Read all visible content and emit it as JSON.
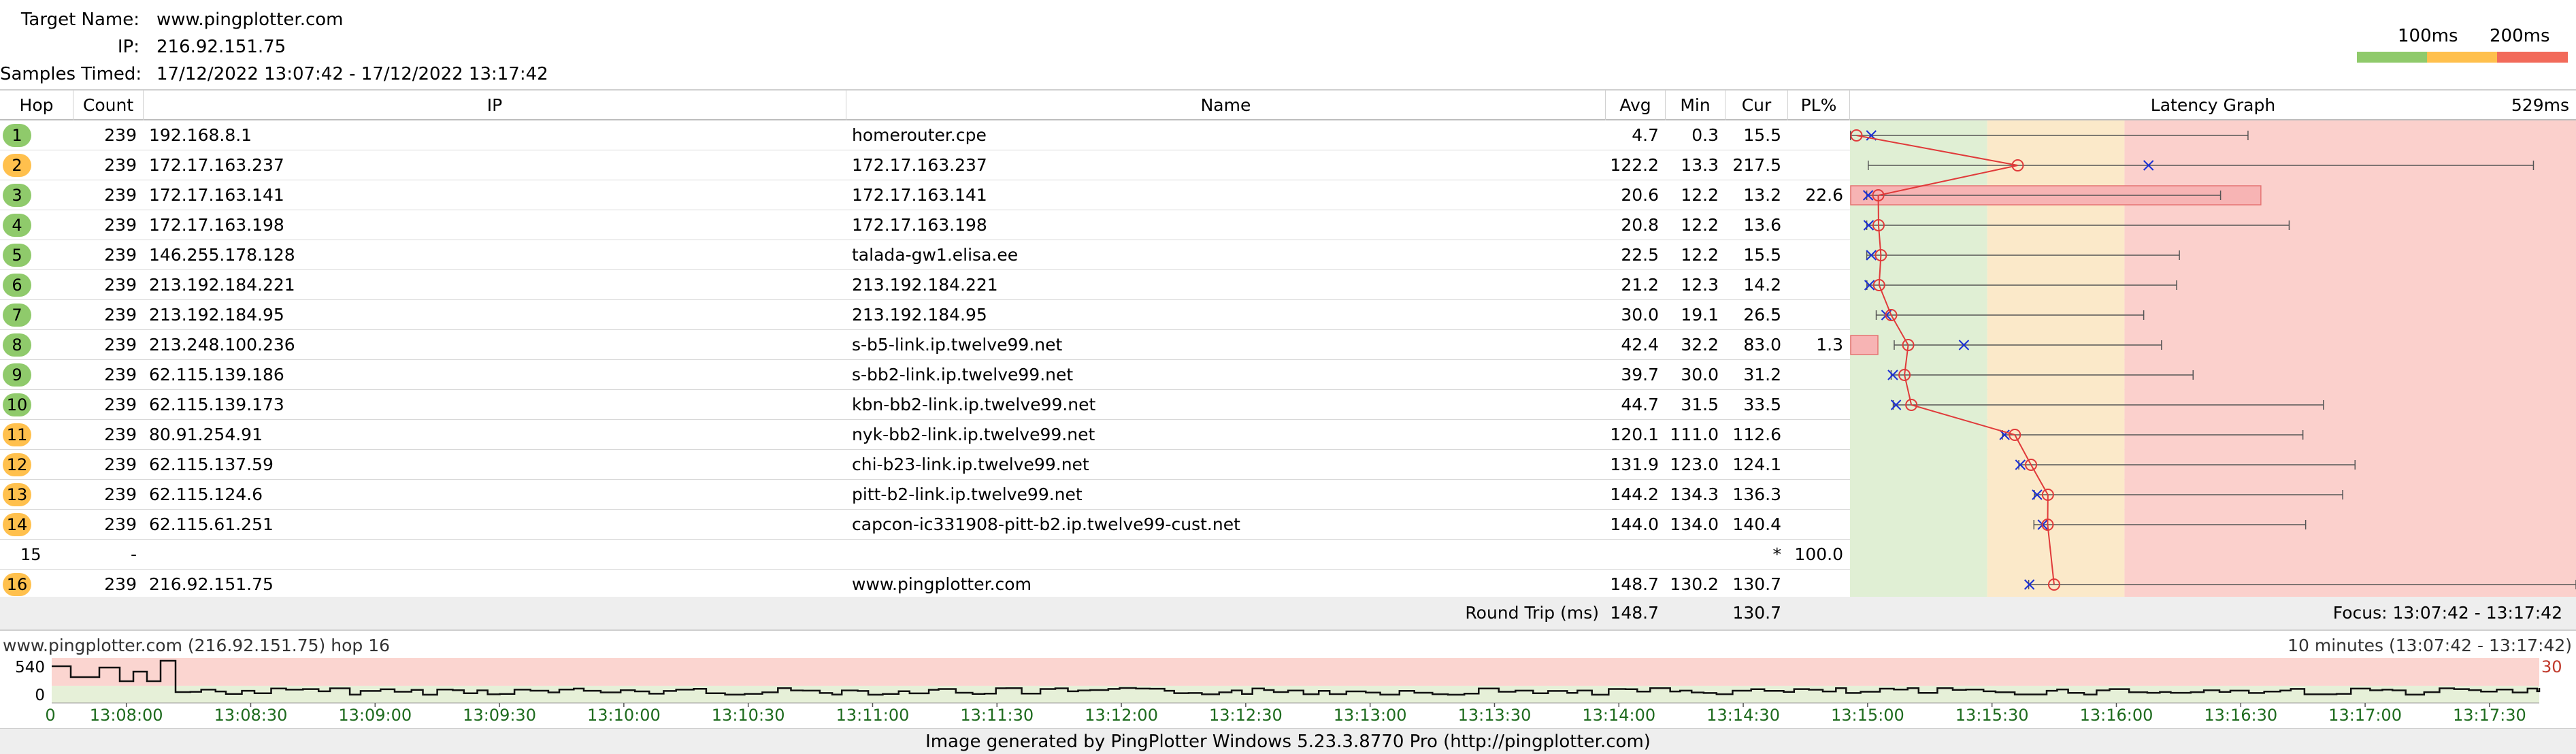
{
  "target": {
    "name_label": "Target Name:",
    "name_value": "www.pingplotter.com",
    "ip_label": "IP:",
    "ip_value": "216.92.151.75",
    "samples_label": "Samples Timed:",
    "samples_value": "17/12/2022 13:07:42 - 17/12/2022 13:17:42"
  },
  "legend": {
    "ms100": "100ms",
    "ms200": "200ms",
    "colors": {
      "good": "#8fca6b",
      "warn": "#ffc04d",
      "bad": "#f26a5a"
    }
  },
  "columns": {
    "hop": "Hop",
    "count": "Count",
    "ip": "IP",
    "name": "Name",
    "avg": "Avg",
    "min": "Min",
    "cur": "Cur",
    "pl": "PL%",
    "graph": "Latency Graph",
    "graph_max": "529ms"
  },
  "hops": [
    {
      "hop": "1",
      "count": "239",
      "ip": "192.168.8.1",
      "name": "homerouter.cpe",
      "avg": "4.7",
      "min": "0.3",
      "cur": "15.5",
      "pl": "",
      "badge": "green",
      "avgv": 4.7,
      "minv": 0.3,
      "curv": 15.5,
      "maxv": 290,
      "plv": 0
    },
    {
      "hop": "2",
      "count": "239",
      "ip": "172.17.163.237",
      "name": "172.17.163.237",
      "avg": "122.2",
      "min": "13.3",
      "cur": "217.5",
      "pl": "",
      "badge": "orange",
      "avgv": 122.2,
      "minv": 13.3,
      "curv": 217.5,
      "maxv": 498,
      "plv": 0
    },
    {
      "hop": "3",
      "count": "239",
      "ip": "172.17.163.141",
      "name": "172.17.163.141",
      "avg": "20.6",
      "min": "12.2",
      "cur": "13.2",
      "pl": "22.6",
      "badge": "green",
      "avgv": 20.6,
      "minv": 12.2,
      "curv": 13.2,
      "maxv": 270,
      "plv": 22.6
    },
    {
      "hop": "4",
      "count": "239",
      "ip": "172.17.163.198",
      "name": "172.17.163.198",
      "avg": "20.8",
      "min": "12.2",
      "cur": "13.6",
      "pl": "",
      "badge": "green",
      "avgv": 20.8,
      "minv": 12.2,
      "curv": 13.6,
      "maxv": 320,
      "plv": 0
    },
    {
      "hop": "5",
      "count": "239",
      "ip": "146.255.178.128",
      "name": "talada-gw1.elisa.ee",
      "avg": "22.5",
      "min": "12.2",
      "cur": "15.5",
      "pl": "",
      "badge": "green",
      "avgv": 22.5,
      "minv": 12.2,
      "curv": 15.5,
      "maxv": 240,
      "plv": 0
    },
    {
      "hop": "6",
      "count": "239",
      "ip": "213.192.184.221",
      "name": "213.192.184.221",
      "avg": "21.2",
      "min": "12.3",
      "cur": "14.2",
      "pl": "",
      "badge": "green",
      "avgv": 21.2,
      "minv": 12.3,
      "curv": 14.2,
      "maxv": 238,
      "plv": 0
    },
    {
      "hop": "7",
      "count": "239",
      "ip": "213.192.184.95",
      "name": "213.192.184.95",
      "avg": "30.0",
      "min": "19.1",
      "cur": "26.5",
      "pl": "",
      "badge": "green",
      "avgv": 30.0,
      "minv": 19.1,
      "curv": 26.5,
      "maxv": 214,
      "plv": 0
    },
    {
      "hop": "8",
      "count": "239",
      "ip": "213.248.100.236",
      "name": "s-b5-link.ip.twelve99.net",
      "avg": "42.4",
      "min": "32.2",
      "cur": "83.0",
      "pl": "1.3",
      "badge": "green",
      "avgv": 42.4,
      "minv": 32.2,
      "curv": 83.0,
      "maxv": 227,
      "plv": 1.3
    },
    {
      "hop": "9",
      "count": "239",
      "ip": "62.115.139.186",
      "name": "s-bb2-link.ip.twelve99.net",
      "avg": "39.7",
      "min": "30.0",
      "cur": "31.2",
      "pl": "",
      "badge": "green",
      "avgv": 39.7,
      "minv": 30.0,
      "curv": 31.2,
      "maxv": 250,
      "plv": 0
    },
    {
      "hop": "10",
      "count": "239",
      "ip": "62.115.139.173",
      "name": "kbn-bb2-link.ip.twelve99.net",
      "avg": "44.7",
      "min": "31.5",
      "cur": "33.5",
      "pl": "",
      "badge": "green",
      "avgv": 44.7,
      "minv": 31.5,
      "curv": 33.5,
      "maxv": 345,
      "plv": 0
    },
    {
      "hop": "11",
      "count": "239",
      "ip": "80.91.254.91",
      "name": "nyk-bb2-link.ip.twelve99.net",
      "avg": "120.1",
      "min": "111.0",
      "cur": "112.6",
      "pl": "",
      "badge": "orange",
      "avgv": 120.1,
      "minv": 111.0,
      "curv": 112.6,
      "maxv": 330,
      "plv": 0
    },
    {
      "hop": "12",
      "count": "239",
      "ip": "62.115.137.59",
      "name": "chi-b23-link.ip.twelve99.net",
      "avg": "131.9",
      "min": "123.0",
      "cur": "124.1",
      "pl": "",
      "badge": "orange",
      "avgv": 131.9,
      "minv": 123.0,
      "curv": 124.1,
      "maxv": 368,
      "plv": 0
    },
    {
      "hop": "13",
      "count": "239",
      "ip": "62.115.124.6",
      "name": "pitt-b2-link.ip.twelve99.net",
      "avg": "144.2",
      "min": "134.3",
      "cur": "136.3",
      "pl": "",
      "badge": "orange",
      "avgv": 144.2,
      "minv": 134.3,
      "curv": 136.3,
      "maxv": 359,
      "plv": 0
    },
    {
      "hop": "14",
      "count": "239",
      "ip": "62.115.61.251",
      "name": "capcon-ic331908-pitt-b2.ip.twelve99-cust.net",
      "avg": "144.0",
      "min": "134.0",
      "cur": "140.4",
      "pl": "",
      "badge": "orange",
      "avgv": 144.0,
      "minv": 134.0,
      "curv": 140.4,
      "maxv": 332,
      "plv": 0
    },
    {
      "hop": "15",
      "count": "-",
      "ip": "",
      "name": "",
      "avg": "",
      "min": "",
      "cur": "*",
      "pl": "100.0",
      "badge": "none",
      "avgv": null,
      "minv": null,
      "curv": null,
      "maxv": null,
      "plv": 100
    },
    {
      "hop": "16",
      "count": "239",
      "ip": "216.92.151.75",
      "name": "www.pingplotter.com",
      "avg": "148.7",
      "min": "130.2",
      "cur": "130.7",
      "pl": "",
      "badge": "orange",
      "avgv": 148.7,
      "minv": 130.2,
      "curv": 130.7,
      "maxv": 529,
      "plv": 0
    }
  ],
  "round_trip": {
    "label": "Round Trip (ms)",
    "avg": "148.7",
    "cur": "130.7",
    "focus": "Focus: 13:07:42 - 13:17:42"
  },
  "timeline": {
    "title": "www.pingplotter.com (216.92.151.75) hop 16",
    "range": "10 minutes (13:07:42 - 13:17:42)",
    "y_max": "540",
    "y_min": "0",
    "right_label": "30",
    "left_tick": "0",
    "ticks": [
      "13:08:00",
      "13:08:30",
      "13:09:00",
      "13:09:30",
      "13:10:00",
      "13:10:30",
      "13:11:00",
      "13:11:30",
      "13:12:00",
      "13:12:30",
      "13:13:00",
      "13:13:30",
      "13:14:00",
      "13:14:30",
      "13:15:00",
      "13:15:30",
      "13:16:00",
      "13:16:30",
      "13:17:00",
      "13:17:30"
    ]
  },
  "footer": "Image generated by PingPlotter Windows 5.23.3.8770 Pro (http://pingplotter.com)"
}
